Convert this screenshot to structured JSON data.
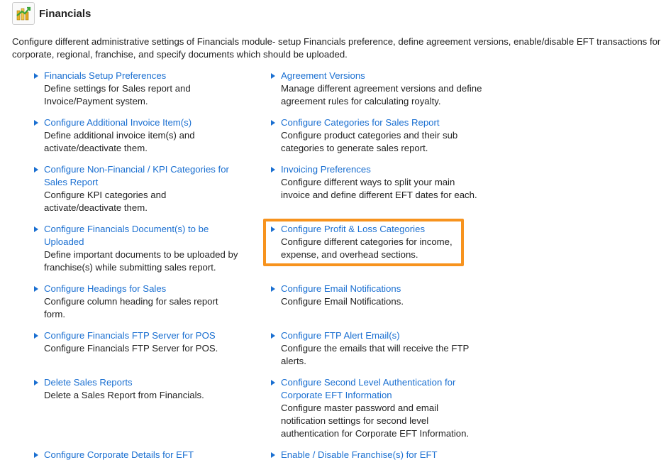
{
  "module": {
    "icon": "financials-icon",
    "title": "Financials",
    "description": "Configure different administrative settings of Financials module- setup Financials preference, define agreement versions, enable/disable EFT transactions for corporate, regional, franchise, and specify documents which should be uploaded."
  },
  "colors": {
    "link": "#1a6fd1",
    "highlight": "#f7931e",
    "bullet": "#1a6fd1"
  },
  "left_items": [
    {
      "title": "Financials Setup Preferences",
      "desc": "Define settings for Sales report and Invoice/Payment system."
    },
    {
      "title": "Configure Additional Invoice Item(s)",
      "desc": "Define additional invoice item(s) and activate/deactivate them."
    },
    {
      "title": "Configure Non-Financial / KPI Categories for Sales Report",
      "desc": "Configure KPI categories and activate/deactivate them."
    },
    {
      "title": "Configure Financials Document(s) to be Uploaded",
      "desc": "Define important documents to be uploaded by franchise(s) while submitting sales report."
    },
    {
      "title": "Configure Headings for Sales",
      "desc": "Configure column heading for sales report form."
    },
    {
      "title": "Configure Financials FTP Server for POS",
      "desc": "Configure Financials FTP Server for POS."
    },
    {
      "title": "Delete Sales Reports",
      "desc": "Delete a Sales Report from Financials."
    },
    {
      "title": "Configure Corporate Details for EFT",
      "desc": ""
    }
  ],
  "right_items": [
    {
      "title": "Agreement Versions",
      "desc": "Manage different agreement versions and define agreement rules for calculating royalty."
    },
    {
      "title": "Configure Categories for Sales Report",
      "desc": "Configure product categories and their sub categories to generate sales report."
    },
    {
      "title": "Invoicing Preferences",
      "desc": "Configure different ways to split your main invoice and define different EFT dates for each."
    },
    {
      "title": "Configure Profit & Loss Categories",
      "desc": "Configure different categories for income, expense, and overhead sections."
    },
    {
      "title": "Configure Email Notifications",
      "desc": "Configure Email Notifications."
    },
    {
      "title": "Configure FTP Alert Email(s)",
      "desc": "Configure the emails that will receive the FTP alerts."
    },
    {
      "title": "Configure Second Level Authentication for Corporate EFT Information",
      "desc": "Configure master password and email notification settings for second level authentication for Corporate EFT Information."
    },
    {
      "title": "Enable / Disable Franchise(s) for EFT",
      "desc": ""
    }
  ]
}
